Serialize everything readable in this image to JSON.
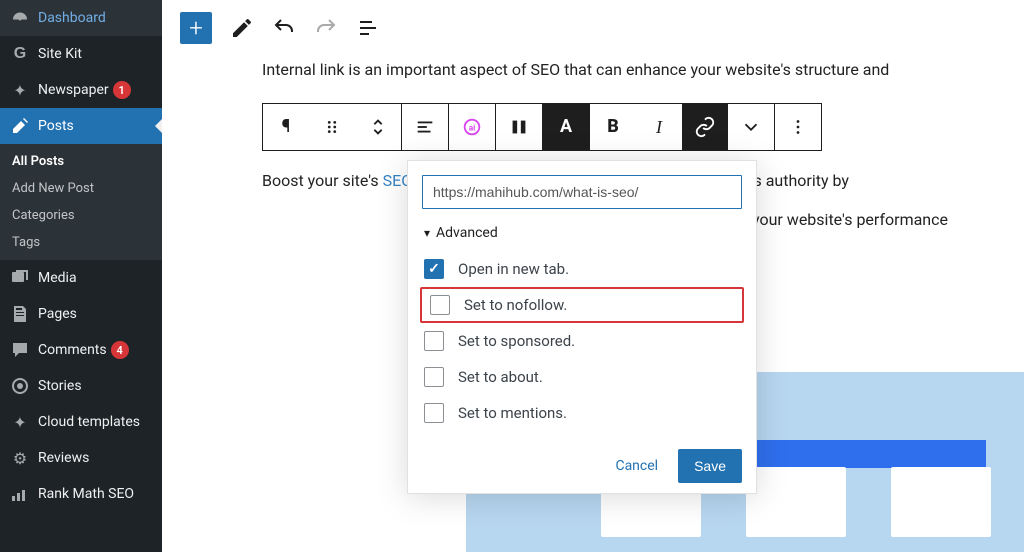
{
  "sidebar": {
    "items": [
      {
        "label": "Dashboard",
        "icon": "⌂"
      },
      {
        "label": "Site Kit",
        "icon": "G"
      },
      {
        "label": "Newspaper",
        "icon": "✦",
        "badge": "1"
      },
      {
        "label": "Posts",
        "icon": "📌",
        "active": true
      },
      {
        "label": "Media",
        "icon": "🖾"
      },
      {
        "label": "Pages",
        "icon": "▤"
      },
      {
        "label": "Comments",
        "icon": "💬",
        "badge": "4"
      },
      {
        "label": "Stories",
        "icon": "⬤"
      },
      {
        "label": "Cloud templates",
        "icon": "✦"
      },
      {
        "label": "Reviews",
        "icon": "⚙"
      },
      {
        "label": "Rank Math SEO",
        "icon": "📈"
      }
    ],
    "sub": [
      {
        "label": "All Posts",
        "current": true
      },
      {
        "label": "Add New Post"
      },
      {
        "label": "Categories"
      },
      {
        "label": "Tags"
      }
    ]
  },
  "content": {
    "line1": "Internal link is an important aspect of SEO that can enhance your website's structure and",
    "line2a": "Boost your site's ",
    "line2link": "SEO",
    "line2b": ", increase page views, and improve your website's authority by",
    "line3": "egy today and watch your website's performance"
  },
  "link_popover": {
    "url": "https://mahihub.com/what-is-seo/",
    "advanced_label": "Advanced",
    "options": [
      {
        "label": "Open in new tab.",
        "checked": true,
        "highlight": false
      },
      {
        "label": "Set to nofollow.",
        "checked": false,
        "highlight": true
      },
      {
        "label": "Set to sponsored.",
        "checked": false,
        "highlight": false
      },
      {
        "label": "Set to about.",
        "checked": false,
        "highlight": false
      },
      {
        "label": "Set to mentions.",
        "checked": false,
        "highlight": false
      }
    ],
    "cancel": "Cancel",
    "save": "Save"
  }
}
